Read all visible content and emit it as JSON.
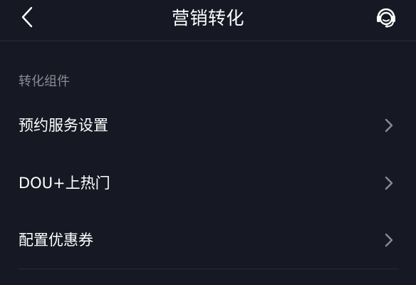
{
  "header": {
    "title": "营销转化",
    "back_icon": "chevron-left-icon",
    "service_icon": "customer-service-icon"
  },
  "section": {
    "label": "转化组件"
  },
  "items": [
    {
      "label": "预约服务设置",
      "icon": "chevron-right-icon"
    },
    {
      "label": "DOU+上热门",
      "icon": "chevron-right-icon"
    },
    {
      "label": "配置优惠券",
      "icon": "chevron-right-icon"
    }
  ],
  "colors": {
    "background": "#161823",
    "text": "#ffffff",
    "muted": "#8a8b92",
    "chevron": "#8a8b92",
    "divider": "#2a2c37"
  }
}
